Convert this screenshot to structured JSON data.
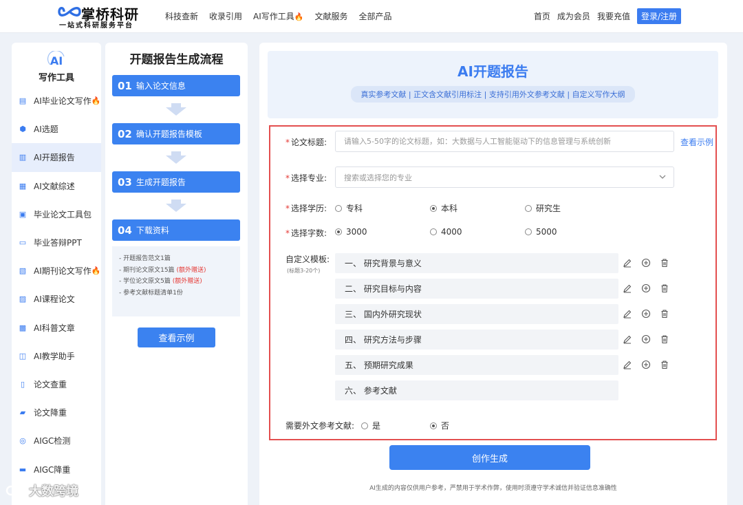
{
  "header": {
    "logo_title": "掌桥科研",
    "logo_sub": "一站式科研服务平台",
    "nav": [
      {
        "label": "科技查新"
      },
      {
        "label": "收录引用"
      },
      {
        "label": "AI写作工具",
        "hot": true
      },
      {
        "label": "文献服务"
      },
      {
        "label": "全部产品"
      }
    ],
    "right": {
      "home": "首页",
      "member": "成为会员",
      "recharge": "我要充值",
      "login": "登录/注册"
    }
  },
  "sidebar": {
    "logo": "AI",
    "title": "写作工具",
    "items": [
      {
        "label": "AI毕业论文写作",
        "hot": true,
        "icon": "doc-icon"
      },
      {
        "label": "AI选题",
        "icon": "ai-badge-icon"
      },
      {
        "label": "AI开题报告",
        "active": true,
        "icon": "report-icon"
      },
      {
        "label": "AI文献综述",
        "icon": "review-icon"
      },
      {
        "label": "毕业论文工具包",
        "icon": "toolkit-icon"
      },
      {
        "label": "毕业答辩PPT",
        "icon": "ppt-icon"
      },
      {
        "label": "AI期刊论文写作",
        "hot": true,
        "icon": "journal-icon"
      },
      {
        "label": "AI课程论文",
        "icon": "course-icon"
      },
      {
        "label": "AI科普文章",
        "icon": "science-icon"
      },
      {
        "label": "AI教学助手",
        "icon": "teach-icon"
      },
      {
        "label": "论文查重",
        "icon": "check-icon"
      },
      {
        "label": "论文降重",
        "icon": "reduce-icon"
      },
      {
        "label": "AIGC检测",
        "icon": "detect-icon"
      },
      {
        "label": "AIGC降重",
        "icon": "aigc-reduce-icon"
      }
    ]
  },
  "flow": {
    "title": "开题报告生成流程",
    "steps": [
      {
        "num": "01",
        "label": "输入论文信息"
      },
      {
        "num": "02",
        "label": "确认开题报告模板"
      },
      {
        "num": "03",
        "label": "生成开题报告"
      },
      {
        "num": "04",
        "label": "下载资料"
      }
    ],
    "notes": [
      {
        "text": "- 开题报告范文1篇",
        "extra": ""
      },
      {
        "text": "- 期刊论文原文15篇",
        "extra": "(额外赠送)"
      },
      {
        "text": "- 学位论文原文5篇",
        "extra": "(额外赠送)"
      },
      {
        "text": "- 参考文献标题清单1份",
        "extra": ""
      }
    ],
    "example_button": "查看示例"
  },
  "main": {
    "title": "AI开题报告",
    "tagline": "真实参考文献 | 正文含文献引用标注 | 支持引用外文参考文献 | 自定义写作大纲",
    "form": {
      "title_label": "论文标题:",
      "title_placeholder": "请输入5-50字的论文标题，如：大数据与人工智能驱动下的信息管理与系统创新",
      "view_example": "查看示例",
      "major_label": "选择专业:",
      "major_placeholder": "搜索或选择您的专业",
      "degree_label": "选择学历:",
      "degree_options": [
        {
          "label": "专科",
          "checked": false
        },
        {
          "label": "本科",
          "checked": true
        },
        {
          "label": "研究生",
          "checked": false
        }
      ],
      "words_label": "选择字数:",
      "words_options": [
        {
          "label": "3000",
          "checked": true
        },
        {
          "label": "4000",
          "checked": false
        },
        {
          "label": "5000",
          "checked": false
        }
      ],
      "template_label": "自定义模板:",
      "template_sub": "(标题3-20个)",
      "template_items": [
        "一、 研究背景与意义",
        "二、 研究目标与内容",
        "三、 国内外研究现状",
        "四、 研究方法与步骤",
        "五、 预期研究成果",
        "六、 参考文献"
      ],
      "foreign_label": "需要外文参考文献:",
      "foreign_options": [
        {
          "label": "是",
          "checked": false
        },
        {
          "label": "否",
          "checked": true
        }
      ]
    },
    "generate_button": "创作生成",
    "disclaimer": "AI生成的内容仅供用户参考，严禁用于学术作弊，使用时须遵守学术诚信并验证信息准确性"
  },
  "watermark": "大数跨境",
  "colors": {
    "accent": "#3b82f0",
    "highlight_border": "#e34e4e",
    "hot": "#f26b1d",
    "gift": "#e53935"
  }
}
